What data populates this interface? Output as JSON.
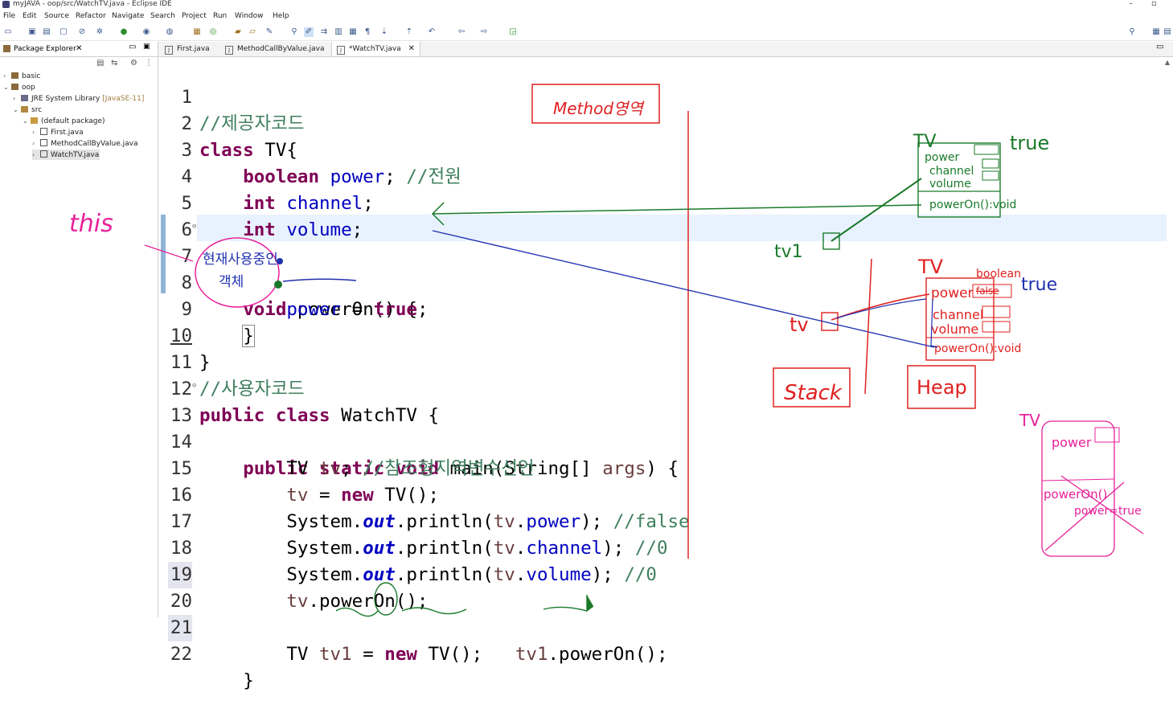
{
  "window": {
    "title": "myJAVA - oop/src/WatchTV.java - Eclipse IDE"
  },
  "menu": [
    "File",
    "Edit",
    "Source",
    "Refactor",
    "Navigate",
    "Search",
    "Project",
    "Run",
    "Window",
    "Help"
  ],
  "package_explorer": {
    "title": "Package Explorer",
    "tree": [
      {
        "label": "basic"
      },
      {
        "label": "oop"
      },
      {
        "label": "JRE System Library",
        "extra": "[JavaSE-11]"
      },
      {
        "label": "src"
      },
      {
        "label": "(default package)"
      },
      {
        "label": "First.java"
      },
      {
        "label": "MethodCallByValue.java"
      },
      {
        "label": "WatchTV.java"
      }
    ]
  },
  "editor_tabs": [
    {
      "label": "First.java"
    },
    {
      "label": "MethodCallByValue.java"
    },
    {
      "label": "*WatchTV.java"
    }
  ],
  "line_numbers": [
    "1",
    "2",
    "3",
    "4",
    "5",
    "6",
    "7",
    "8",
    "9",
    "10",
    "11",
    "12",
    "13",
    "14",
    "15",
    "16",
    "17",
    "18",
    "19",
    "20",
    "21",
    "22"
  ],
  "code": {
    "l1": "//제공자코드",
    "l2a": "class",
    "l2b": " TV{",
    "l3a": "boolean",
    "l3b": "power",
    "l3c": "; ",
    "l3d": "//전원",
    "l4a": "int",
    "l4b": "channel",
    "l4c": ";",
    "l5a": "int",
    "l5b": "volume",
    "l5c": ";",
    "l7a": "void",
    "l7b": " powerOn() {",
    "l8a": "power",
    "l8b": " = ",
    "l8c": "true",
    "l8d": ";",
    "l9": "}",
    "l10": "}",
    "l11": "//사용자코드",
    "l12a": "public",
    "l12b": "class",
    "l12c": " WatchTV {",
    "l13a": "public",
    "l13b": "static",
    "l13c": "void",
    "l13d": " main(String[] ",
    "l13e": "args",
    "l13f": ") {",
    "l14a": "TV ",
    "l14b": "tv",
    "l14c": "; ",
    "l14d": "//참조형지역변수선언",
    "l15a": "tv",
    "l15b": " = ",
    "l15c": "new",
    "l15d": " TV();",
    "l16a": "System.",
    "l16b": "out",
    "l16c": ".println(",
    "l16d": "tv",
    "l16e": ".",
    "l16f": "power",
    "l16g": "); ",
    "l16h": "//false",
    "l17a": "System.",
    "l17b": "out",
    "l17c": ".println(",
    "l17d": "tv",
    "l17e": ".",
    "l17f": "channel",
    "l17g": "); ",
    "l17h": "//0",
    "l18a": "System.",
    "l18b": "out",
    "l18c": ".println(",
    "l18d": "tv",
    "l18e": ".",
    "l18f": "volume",
    "l18g": "); ",
    "l18h": "//0",
    "l19a": "tv",
    "l19b": ".powerOn();",
    "l21a": "TV ",
    "l21b": "tv1",
    "l21c": " = ",
    "l21d": "new",
    "l21e": " TV();   ",
    "l21f": "tv1",
    "l21g": ".powerOn();",
    "l22": "}"
  },
  "annotations": {
    "method_area": "Method영역",
    "this": "this",
    "current_object": "현재사용중인",
    "current_object2": "객체",
    "tv_green": "TV",
    "power": "power",
    "channel": "channel",
    "volume": "volume",
    "powerOn_void": "powerOn():void",
    "true": "true",
    "tv1": "tv1",
    "tv_red": "TV",
    "boolean": "boolean",
    "false": "false",
    "tv_label": "tv",
    "stack": "Stack",
    "heap": "Heap",
    "tv_pink": "TV",
    "powerOn_pink": "powerOn()",
    "power_true": "power=true"
  }
}
